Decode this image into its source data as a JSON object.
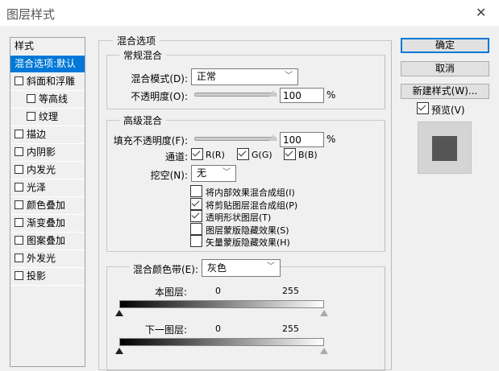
{
  "window": {
    "title": "图层样式",
    "close": "✕"
  },
  "sidebar": {
    "header": "样式",
    "items": [
      {
        "label": "混合选项:默认",
        "selected": true,
        "checkbox": false
      },
      {
        "label": "斜面和浮雕",
        "checkbox": true,
        "checked": false
      },
      {
        "label": "等高线",
        "checkbox": true,
        "checked": false,
        "indent": true
      },
      {
        "label": "纹理",
        "checkbox": true,
        "checked": false,
        "indent": true
      },
      {
        "label": "描边",
        "checkbox": true,
        "checked": false
      },
      {
        "label": "内阴影",
        "checkbox": true,
        "checked": false
      },
      {
        "label": "内发光",
        "checkbox": true,
        "checked": false
      },
      {
        "label": "光泽",
        "checkbox": true,
        "checked": false
      },
      {
        "label": "颜色叠加",
        "checkbox": true,
        "checked": false
      },
      {
        "label": "渐变叠加",
        "checkbox": true,
        "checked": false
      },
      {
        "label": "图案叠加",
        "checkbox": true,
        "checked": false
      },
      {
        "label": "外发光",
        "checkbox": true,
        "checked": false
      },
      {
        "label": "投影",
        "checkbox": true,
        "checked": false
      }
    ]
  },
  "blend": {
    "title": "混合选项",
    "general": {
      "title": "常规混合",
      "mode_label": "混合模式(D):",
      "mode_value": "正常",
      "opacity_label": "不透明度(O):",
      "opacity_value": "100",
      "opacity_percent": 100,
      "unit": "%"
    },
    "advanced": {
      "title": "高级混合",
      "fill_label": "填充不透明度(F):",
      "fill_value": "100",
      "fill_percent": 100,
      "unit": "%",
      "channels_label": "通道:",
      "channels": [
        {
          "label": "R(R)",
          "checked": true
        },
        {
          "label": "G(G)",
          "checked": true
        },
        {
          "label": "B(B)",
          "checked": true
        }
      ],
      "knockout_label": "挖空(N):",
      "knockout_value": "无",
      "options": [
        {
          "label": "将内部效果混合成组(I)",
          "checked": false
        },
        {
          "label": "将剪贴图层混合成组(P)",
          "checked": true
        },
        {
          "label": "透明形状图层(T)",
          "checked": true
        },
        {
          "label": "图层蒙版隐藏效果(S)",
          "checked": false
        },
        {
          "label": "矢量蒙版隐藏效果(H)",
          "checked": false
        }
      ]
    },
    "blendif": {
      "label": "混合颜色带(E):",
      "value": "灰色",
      "this_layer": "本图层:",
      "under_layer": "下一图层:",
      "this_min": "0",
      "this_max": "255",
      "under_min": "0",
      "under_max": "255"
    }
  },
  "buttons": {
    "ok": "确定",
    "cancel": "取消",
    "new_style": "新建样式(W)...",
    "preview_label": "预览(V)",
    "preview_checked": true
  },
  "colors": {
    "selection": "#0078d7",
    "preview_swatch": "#555555"
  }
}
